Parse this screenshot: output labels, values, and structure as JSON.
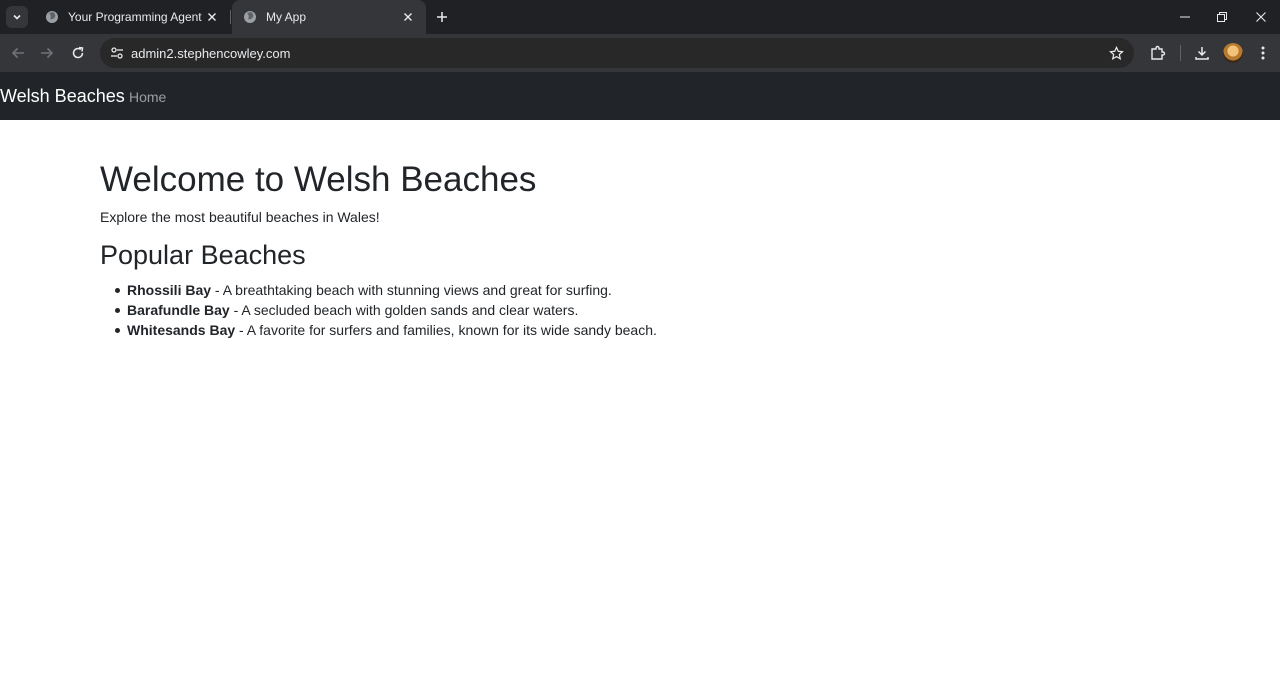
{
  "browser": {
    "tabs": [
      {
        "title": "Your Programming Agent",
        "active": false
      },
      {
        "title": "My App",
        "active": true
      }
    ],
    "address": "admin2.stephencowley.com",
    "icons": {
      "tab_search": "chevron-down-icon",
      "favicon": "globe-icon",
      "tab_close": "close-icon",
      "new_tab": "plus-icon",
      "back": "arrow-left-icon",
      "forward": "arrow-right-icon",
      "reload": "reload-icon",
      "site_info": "tune-icon",
      "bookmark": "star-icon",
      "extensions": "puzzle-icon",
      "downloads": "download-icon",
      "menu": "kebab-menu-icon",
      "minimize": "minimize-icon",
      "restore": "restore-icon",
      "close_window": "close-icon"
    },
    "colors": {
      "tabstrip": "#202124",
      "toolbar": "#35363a",
      "omnibox": "#282828"
    }
  },
  "app": {
    "brand": "Welsh Beaches",
    "nav_links": [
      "Home"
    ],
    "colors": {
      "navbar": "#212529",
      "text": "#212529"
    }
  },
  "content": {
    "heading": "Welcome to Welsh Beaches",
    "lead": "Explore the most beautiful beaches in Wales!",
    "section_title": "Popular Beaches",
    "beaches": [
      {
        "name": "Rhossili Bay",
        "description": " - A breathtaking beach with stunning views and great for surfing."
      },
      {
        "name": "Barafundle Bay",
        "description": " - A secluded beach with golden sands and clear waters."
      },
      {
        "name": "Whitesands Bay",
        "description": " - A favorite for surfers and families, known for its wide sandy beach."
      }
    ]
  }
}
